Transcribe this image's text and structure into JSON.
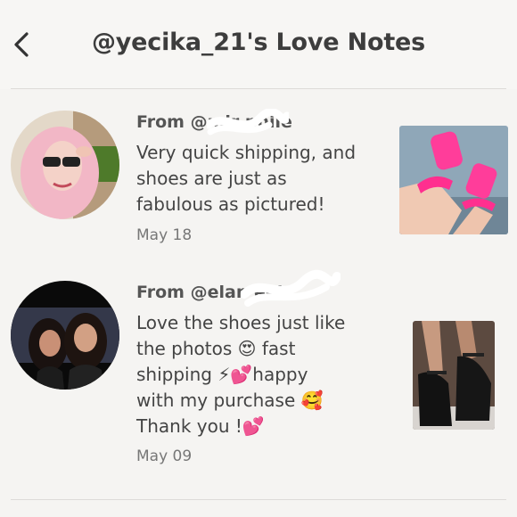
{
  "header": {
    "title": "@yecika_21's Love Notes",
    "back_icon": "chevron-left-icon"
  },
  "notes": [
    {
      "from": "From @mir      phile",
      "message": "Very quick shipping, and\nshoes are just as\nfabulous as pictured!",
      "date": "May 18",
      "product_image": "pink-platform-heels-photo"
    },
    {
      "from": "From @elan            eek",
      "message": "Love the shoes just like\nthe photos 😍 fast\nshipping ⚡💕happy\nwith my purchase 🥰\nThank you !💕",
      "date": "May 09",
      "product_image": "black-platform-heels-photo"
    }
  ]
}
